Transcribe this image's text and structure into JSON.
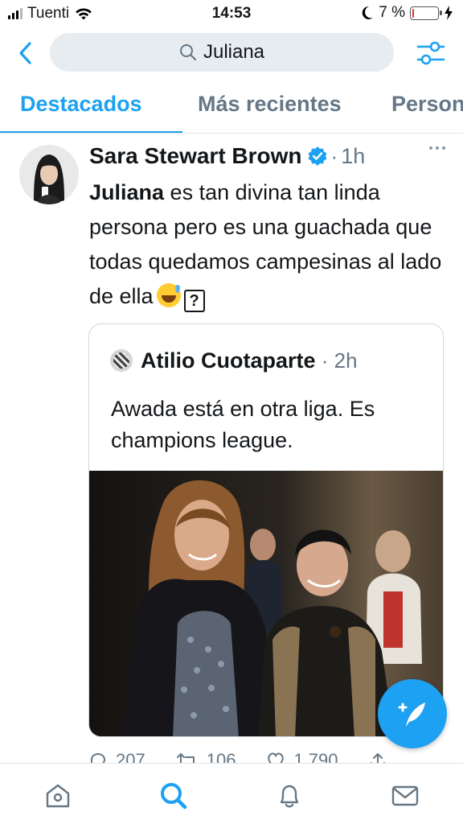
{
  "status_bar": {
    "carrier": "Tuenti",
    "time": "14:53",
    "battery_text": "7 %",
    "battery_level": 0.07,
    "battery_color": "#e0332d"
  },
  "search": {
    "query": "Juliana",
    "back_icon": "chevron-left-icon",
    "filter_icon": "sliders-icon"
  },
  "tabs": [
    {
      "label": "Destacados",
      "active": true
    },
    {
      "label": "Más recientes",
      "active": false
    },
    {
      "label": "Person",
      "active": false
    }
  ],
  "tweet": {
    "author_name": "Sara Stewart Brown",
    "verified": true,
    "time": "1h",
    "text_bold": "Juliana",
    "text_rest": " es tan divina tan linda persona pero es una guachada que todas quedamos campesinas al lado de ella",
    "emoji": "grinning-sweat-emoji",
    "unknown_glyph": "?",
    "quote": {
      "author_name": "Atilio Cuotaparte",
      "time": "2h",
      "text": "Awada está en otra liga. Es champions league."
    },
    "actions": {
      "replies": "207",
      "retweets": "106",
      "likes": "1.790"
    }
  },
  "bottom_nav": [
    {
      "name": "home-icon",
      "active": false
    },
    {
      "name": "search-icon",
      "active": true
    },
    {
      "name": "notifications-icon",
      "active": false
    },
    {
      "name": "messages-icon",
      "active": false
    }
  ],
  "colors": {
    "accent": "#1da1f2",
    "text": "#14171a",
    "secondary": "#657786"
  }
}
